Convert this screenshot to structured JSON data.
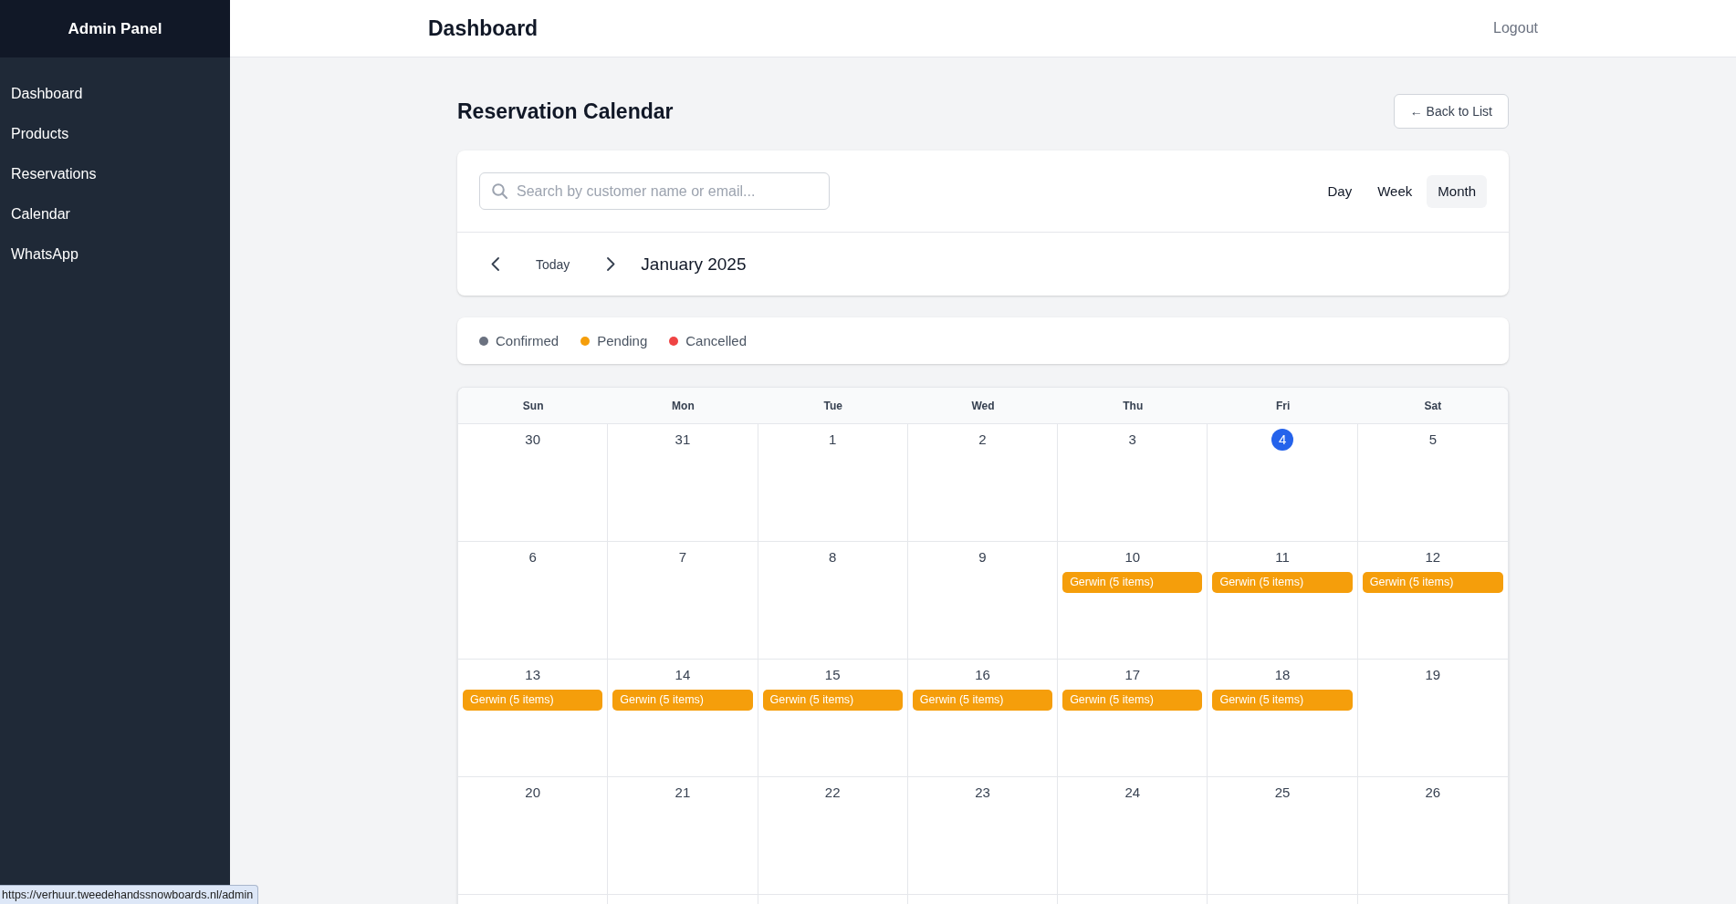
{
  "sidebar": {
    "title": "Admin Panel",
    "items": [
      {
        "label": "Dashboard"
      },
      {
        "label": "Products"
      },
      {
        "label": "Reservations"
      },
      {
        "label": "Calendar"
      },
      {
        "label": "WhatsApp"
      }
    ]
  },
  "header": {
    "title": "Dashboard",
    "logout": "Logout"
  },
  "page": {
    "title": "Reservation Calendar",
    "back_button": "← Back to List"
  },
  "toolbar": {
    "search": {
      "placeholder": "Search by customer name or email..."
    },
    "views": [
      {
        "label": "Day",
        "selected": false
      },
      {
        "label": "Week",
        "selected": false
      },
      {
        "label": "Month",
        "selected": true
      }
    ],
    "nav": {
      "today": "Today",
      "period": "January 2025"
    }
  },
  "legend": {
    "items": [
      {
        "label": "Confirmed",
        "color": "#6b7280"
      },
      {
        "label": "Pending",
        "color": "#f59e0b"
      },
      {
        "label": "Cancelled",
        "color": "#ef4444"
      }
    ]
  },
  "calendar": {
    "weekdays": [
      "Sun",
      "Mon",
      "Tue",
      "Wed",
      "Thu",
      "Fri",
      "Sat"
    ],
    "weeks": [
      {
        "days": [
          {
            "date": "30",
            "today": false
          },
          {
            "date": "31",
            "today": false
          },
          {
            "date": "1",
            "today": false
          },
          {
            "date": "2",
            "today": false
          },
          {
            "date": "3",
            "today": false
          },
          {
            "date": "4",
            "today": true
          },
          {
            "date": "5",
            "today": false
          }
        ]
      },
      {
        "days": [
          {
            "date": "6",
            "today": false
          },
          {
            "date": "7",
            "today": false
          },
          {
            "date": "8",
            "today": false
          },
          {
            "date": "9",
            "today": false
          },
          {
            "date": "10",
            "today": false,
            "events": [
              {
                "label": "Gerwin (5 items)",
                "color": "#f59e0b"
              }
            ]
          },
          {
            "date": "11",
            "today": false,
            "events": [
              {
                "label": "Gerwin (5 items)",
                "color": "#f59e0b"
              }
            ]
          },
          {
            "date": "12",
            "today": false,
            "events": [
              {
                "label": "Gerwin (5 items)",
                "color": "#f59e0b"
              }
            ]
          }
        ]
      },
      {
        "days": [
          {
            "date": "13",
            "today": false,
            "events": [
              {
                "label": "Gerwin (5 items)",
                "color": "#f59e0b"
              }
            ]
          },
          {
            "date": "14",
            "today": false,
            "events": [
              {
                "label": "Gerwin (5 items)",
                "color": "#f59e0b"
              }
            ]
          },
          {
            "date": "15",
            "today": false,
            "events": [
              {
                "label": "Gerwin (5 items)",
                "color": "#f59e0b"
              }
            ]
          },
          {
            "date": "16",
            "today": false,
            "events": [
              {
                "label": "Gerwin (5 items)",
                "color": "#f59e0b"
              }
            ]
          },
          {
            "date": "17",
            "today": false,
            "events": [
              {
                "label": "Gerwin (5 items)",
                "color": "#f59e0b"
              }
            ]
          },
          {
            "date": "18",
            "today": false,
            "events": [
              {
                "label": "Gerwin (5 items)",
                "color": "#f59e0b"
              }
            ]
          },
          {
            "date": "19",
            "today": false
          }
        ]
      },
      {
        "days": [
          {
            "date": "20",
            "today": false
          },
          {
            "date": "21",
            "today": false
          },
          {
            "date": "22",
            "today": false
          },
          {
            "date": "23",
            "today": false
          },
          {
            "date": "24",
            "today": false
          },
          {
            "date": "25",
            "today": false
          },
          {
            "date": "26",
            "today": false
          }
        ]
      }
    ]
  },
  "status_bar": {
    "url": "https://verhuur.tweedehandssnowboards.nl/admin"
  }
}
